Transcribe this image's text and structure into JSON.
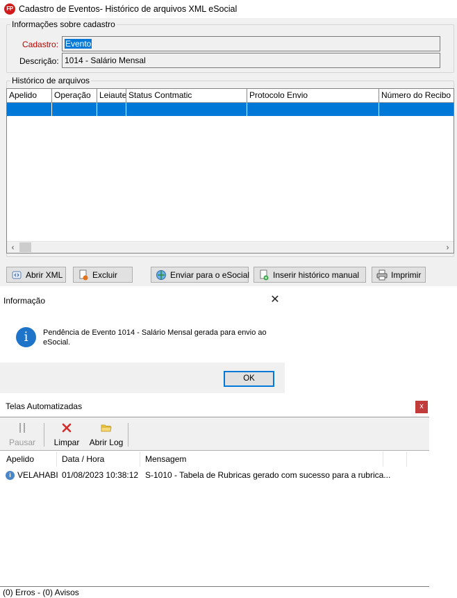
{
  "window1": {
    "title": "Cadastro de Eventos- Histórico de arquivos XML eSocial",
    "logo_text": "FP",
    "info_group": {
      "legend": "Informações sobre cadastro",
      "cadastro_label": "Cadastro:",
      "cadastro_value": "Evento",
      "descricao_label": "Descrição:",
      "descricao_value": "1014 - Salário Mensal"
    },
    "history_group": {
      "legend": "Histórico de arquivos",
      "columns": [
        "Apelido",
        "Operação",
        "Leiaute",
        "Status Contmatic",
        "Protocolo Envio",
        "Número do Recibo"
      ]
    },
    "buttons": {
      "abrir_xml": "Abrir XML",
      "excluir": "Excluir",
      "enviar": "Enviar para o eSocial",
      "inserir": "Inserir histórico manual",
      "imprimir": "Imprimir"
    }
  },
  "window2": {
    "title": "Informação",
    "message": "Pendência de Evento 1014 - Salário Mensal gerada para envio ao eSocial.",
    "ok_label": "OK"
  },
  "window3": {
    "title": "Telas Automatizadas",
    "close_label": "x",
    "toolbar": {
      "pausar": "Pausar",
      "limpar": "Limpar",
      "abrir_log": "Abrir Log"
    },
    "columns": [
      "Apelido",
      "Data / Hora",
      "Mensagem"
    ],
    "rows": [
      {
        "apelido": "VELAHABI",
        "data_hora": "01/08/2023 10:38:12",
        "mensagem": "S-1010 - Tabela de Rubricas gerado com sucesso para a rubrica..."
      }
    ],
    "status": "(0) Erros - (0) Avisos"
  },
  "colors": {
    "selection": "#0078d7",
    "label_required": "#c00000",
    "info_blue": "#1e74c9",
    "close_red": "#c23b3b"
  },
  "icons": {
    "app": "fp-logo-icon",
    "abrir_xml": "xml-file-icon",
    "excluir": "delete-document-icon",
    "enviar": "send-globe-icon",
    "inserir": "add-document-icon",
    "imprimir": "printer-icon",
    "info": "info-icon",
    "pausar": "pause-icon",
    "limpar": "clear-x-icon",
    "abrir_log": "folder-open-icon"
  }
}
